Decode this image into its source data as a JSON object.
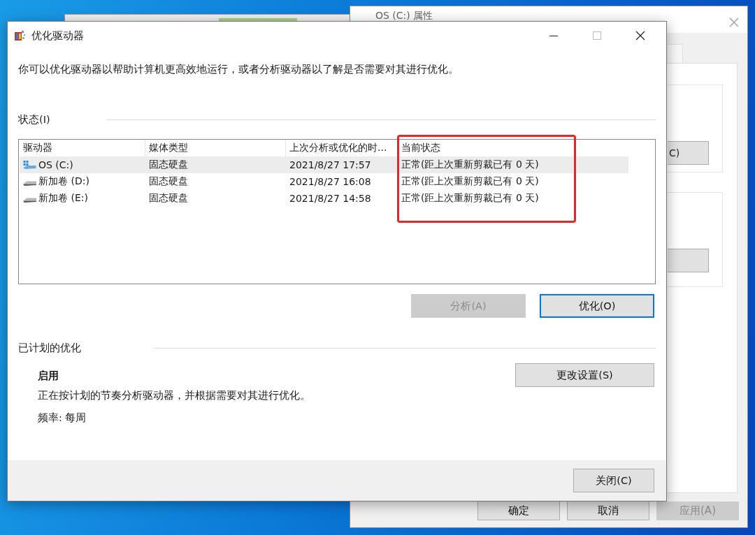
{
  "background_window": {
    "title": "OS (C:) 属性",
    "partial_button": "C)",
    "buttons": [
      {
        "label": "确定",
        "disabled": false
      },
      {
        "label": "取消",
        "disabled": false
      },
      {
        "label": "应用(A)",
        "disabled": true
      }
    ]
  },
  "window": {
    "title": "优化驱动器",
    "description": "你可以优化驱动器以帮助计算机更高效地运行，或者分析驱动器以了解是否需要对其进行优化。",
    "status": {
      "heading": "状态(I)",
      "columns": [
        "驱动器",
        "媒体类型",
        "上次分析或优化的时...",
        "当前状态"
      ],
      "rows": [
        {
          "drive": "OS (C:)",
          "kind": "system",
          "media": "固态硬盘",
          "last": "2021/8/27 17:57",
          "status": "正常(距上次重新剪裁已有 0 天)",
          "selected": true
        },
        {
          "drive": "新加卷 (D:)",
          "kind": "data",
          "media": "固态硬盘",
          "last": "2021/8/27 16:08",
          "status": "正常(距上次重新剪裁已有 0 天)",
          "selected": false
        },
        {
          "drive": "新加卷 (E:)",
          "kind": "data",
          "media": "固态硬盘",
          "last": "2021/8/27 14:58",
          "status": "正常(距上次重新剪裁已有 0 天)",
          "selected": false
        }
      ]
    },
    "actions": [
      {
        "label": "分析(A)",
        "disabled": true,
        "focused": false
      },
      {
        "label": "优化(O)",
        "disabled": false,
        "focused": true
      }
    ],
    "schedule": {
      "heading": "已计划的优化",
      "state": "启用",
      "detail": "正在按计划的节奏分析驱动器，并根据需要对其进行优化。",
      "frequency": "频率: 每周",
      "button": "更改设置(S)"
    },
    "close_button": "关闭(C)"
  },
  "highlight": {
    "kind": "frame"
  }
}
